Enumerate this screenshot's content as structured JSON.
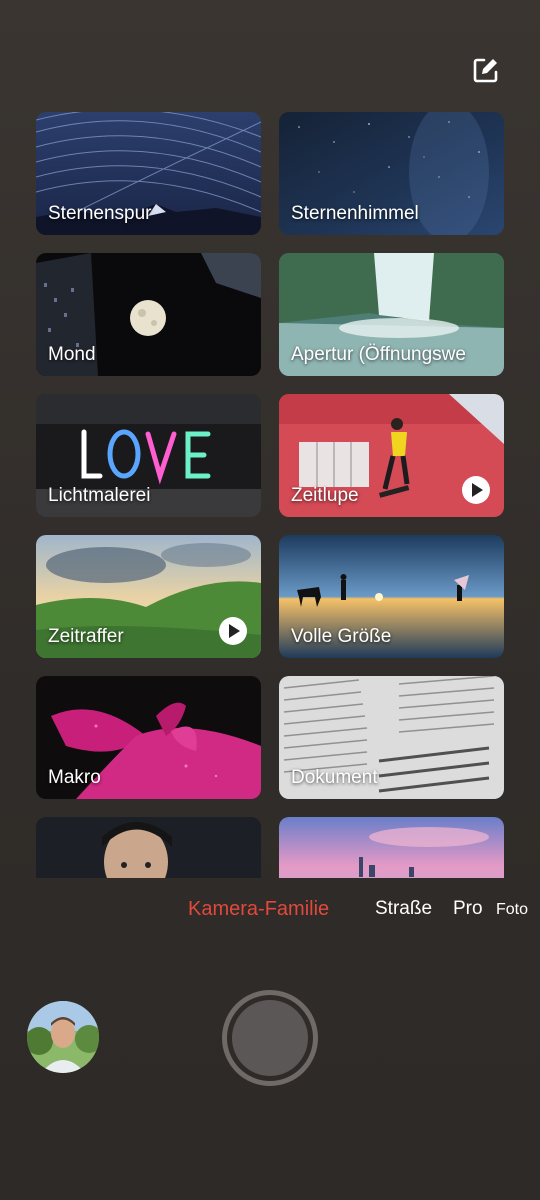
{
  "header": {
    "edit_icon": "edit-icon"
  },
  "tiles": [
    {
      "label": "Sternenspur",
      "video": false
    },
    {
      "label": "Sternenhimmel",
      "video": false
    },
    {
      "label": "Mond",
      "video": false
    },
    {
      "label": "Apertur (Öffnungswe",
      "video": false
    },
    {
      "label": "Lichtmalerei",
      "video": false
    },
    {
      "label": "Zeitlupe",
      "video": true
    },
    {
      "label": "Zeitraffer",
      "video": true
    },
    {
      "label": "Volle Größe",
      "video": false
    },
    {
      "label": "Makro",
      "video": false
    },
    {
      "label": "Dokument",
      "video": false
    }
  ],
  "modes": [
    {
      "label": "Kamera-Familie",
      "active": true
    },
    {
      "label": "Straße",
      "active": false
    },
    {
      "label": "Pro",
      "active": false
    },
    {
      "label": "Foto",
      "active": false
    }
  ],
  "colors": {
    "accent": "#e0493c",
    "background": "#33302c"
  }
}
